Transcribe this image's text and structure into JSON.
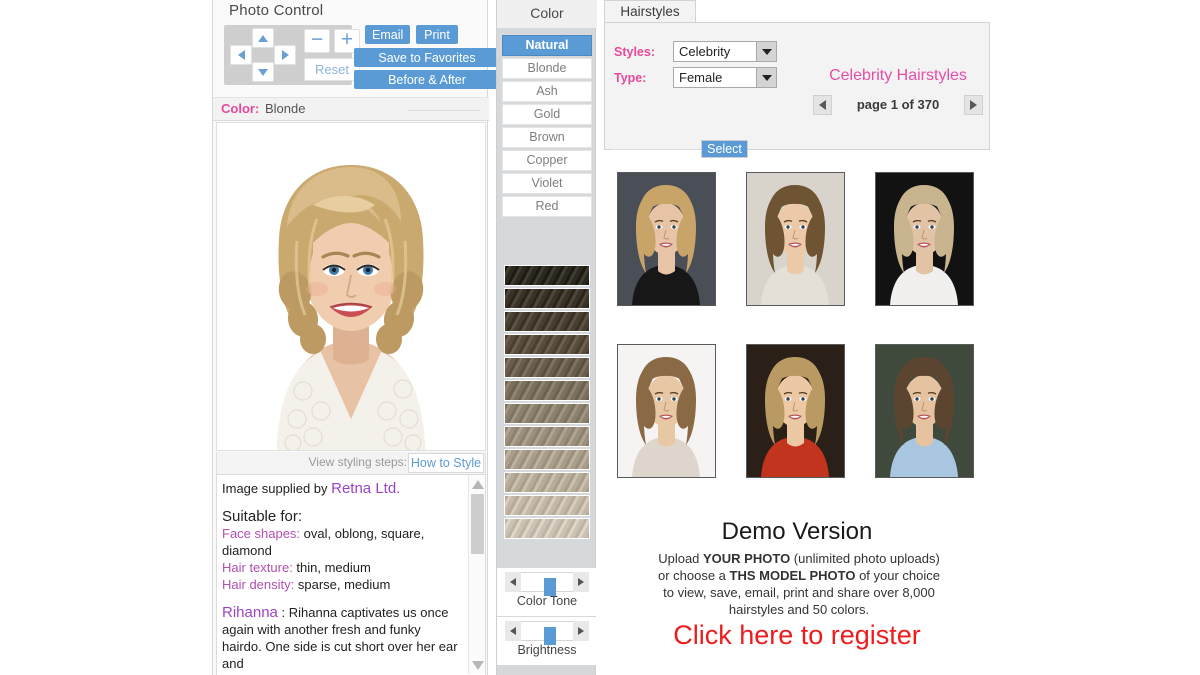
{
  "photo_control": {
    "title": "Photo Control",
    "nav": {
      "up": "nav-up",
      "down": "nav-down",
      "left": "nav-left",
      "right": "nav-right",
      "zoom_out": "−",
      "zoom_in": "+",
      "reset": "Reset"
    },
    "buttons": {
      "email": "Email",
      "print": "Print",
      "save_to_favorites": "Save to Favorites",
      "before_after": "Before & After"
    },
    "color_row": {
      "label": "Color:",
      "value": "Blonde"
    },
    "styling": {
      "view_steps_label": "View styling steps:",
      "how_to_style": "How to Style"
    },
    "description": {
      "supplied_prefix": "Image supplied by ",
      "supplied_source": "Retna Ltd.",
      "suitable_heading": "Suitable for:",
      "face_shapes_label": "Face shapes:",
      "face_shapes_value": " oval, oblong, square, diamond",
      "hair_texture_label": "Hair texture:",
      "hair_texture_value": " thin, medium",
      "hair_density_label": "Hair density:",
      "hair_density_value": " sparse, medium",
      "celebrity_name": "Rihanna",
      "celebrity_text": " : Rihanna captivates us once again with another fresh and funky hairdo. One side is cut short over her ear and"
    }
  },
  "color_panel": {
    "title": "Color",
    "selected": "Natural",
    "items": [
      "Natural",
      "Blonde",
      "Ash",
      "Gold",
      "Brown",
      "Copper",
      "Violet",
      "Red"
    ],
    "swatch_count": 12,
    "swatch_base_colors": [
      "#1d1a12",
      "#2b2519",
      "#3a3125",
      "#4a3f2f",
      "#5b5040",
      "#6d6150",
      "#7e7260",
      "#8d8170",
      "#9b8f7e",
      "#a99d8c",
      "#b6ab9a",
      "#bdb4a6"
    ],
    "sliders": [
      {
        "label": "Color Tone",
        "value": 50
      },
      {
        "label": "Brightness",
        "value": 50
      }
    ]
  },
  "hairstyles": {
    "tab_label": "Hairstyles",
    "styles_label": "Styles:",
    "styles_value": "Celebrity",
    "type_label": "Type:",
    "type_value": "Female",
    "heading": "Celebrity Hairstyles",
    "page_text": "page 1 of 370",
    "prev_label": "previous page",
    "next_label": "next page",
    "select_label": "Select",
    "thumbnails": [
      {
        "name": "thumbnail-1",
        "skin": "#e7c4a6",
        "hair": "#c9a468",
        "bg": "#4a4f57",
        "cloth": "#171717"
      },
      {
        "name": "thumbnail-2",
        "skin": "#eccaa9",
        "hair": "#6f5433",
        "bg": "#d8d4cb",
        "cloth": "#e4e0d8"
      },
      {
        "name": "thumbnail-3",
        "skin": "#e3c3a6",
        "hair": "#c8b48e",
        "bg": "#121212",
        "cloth": "#f2f0ee"
      },
      {
        "name": "thumbnail-4",
        "skin": "#e8c7a5",
        "hair": "#8a6a45",
        "bg": "#f6f4f2",
        "cloth": "#ded6cc"
      },
      {
        "name": "thumbnail-5",
        "skin": "#ecc9a4",
        "hair": "#b99a63",
        "bg": "#2a2018",
        "cloth": "#c3341f"
      },
      {
        "name": "thumbnail-6",
        "skin": "#e6c3a0",
        "hair": "#5c4530",
        "bg": "#3f4a3d",
        "cloth": "#a9c6e0"
      }
    ]
  },
  "demo": {
    "title": "Demo Version",
    "line1_a": "Upload ",
    "line1_b": "YOUR PHOTO",
    "line1_c": " (unlimited photo uploads)",
    "line2_a": "or choose a ",
    "line2_b": "THS MODEL PHOTO",
    "line2_c": " of your choice",
    "line3": "to view, save, email, print and share over 8,000",
    "line4": "hairstyles and 50 colors.",
    "register": "Click here to register"
  },
  "colors": {
    "accent_blue": "#5b9bd5",
    "pink": "#e7499b",
    "magenta_heading": "#e44fa8",
    "red": "#ee1c1c",
    "violet": "#9b44c4"
  }
}
